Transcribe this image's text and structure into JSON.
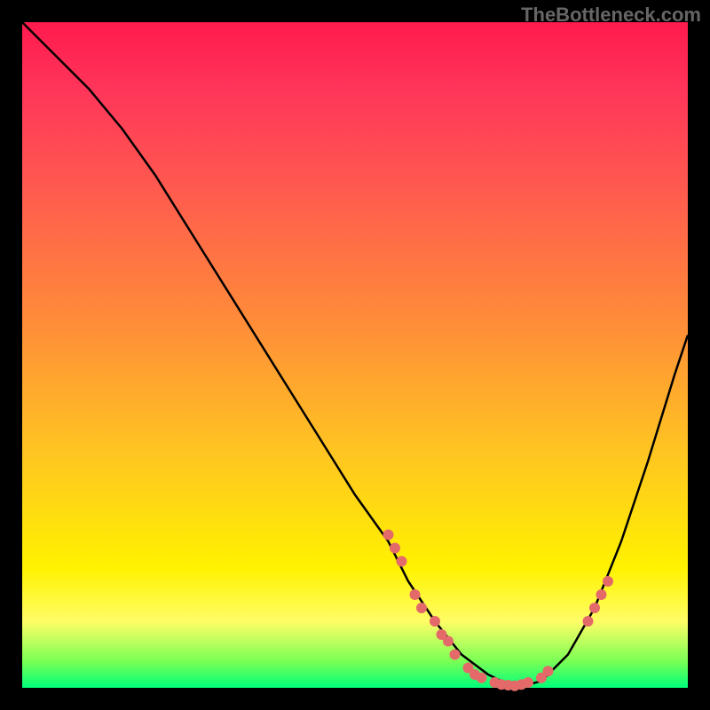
{
  "branding": {
    "watermark": "TheBottleneck.com"
  },
  "chart_data": {
    "type": "line",
    "title": "",
    "xlabel": "",
    "ylabel": "",
    "xlim": [
      0,
      100
    ],
    "ylim": [
      0,
      100
    ],
    "background_gradient": [
      "#ff1a4d",
      "#ff8c39",
      "#fff200",
      "#00ff7a"
    ],
    "series": [
      {
        "name": "bottleneck-curve",
        "color": "#000000",
        "x": [
          0,
          5,
          10,
          15,
          20,
          25,
          30,
          35,
          40,
          45,
          50,
          55,
          58,
          62,
          66,
          70,
          74,
          78,
          82,
          86,
          90,
          94,
          98,
          100
        ],
        "y": [
          100,
          95,
          90,
          84,
          77,
          69,
          61,
          53,
          45,
          37,
          29,
          22,
          16,
          10,
          5,
          2,
          0,
          1,
          5,
          12,
          22,
          34,
          47,
          53
        ]
      }
    ],
    "scatter_points": {
      "name": "highlight-dots",
      "color": "#e46a6a",
      "points": [
        {
          "x": 55,
          "y": 23
        },
        {
          "x": 56,
          "y": 21
        },
        {
          "x": 57,
          "y": 19
        },
        {
          "x": 59,
          "y": 14
        },
        {
          "x": 60,
          "y": 12
        },
        {
          "x": 62,
          "y": 10
        },
        {
          "x": 63,
          "y": 8
        },
        {
          "x": 64,
          "y": 7
        },
        {
          "x": 65,
          "y": 5
        },
        {
          "x": 67,
          "y": 3
        },
        {
          "x": 68,
          "y": 2
        },
        {
          "x": 69,
          "y": 1.5
        },
        {
          "x": 71,
          "y": 0.8
        },
        {
          "x": 72,
          "y": 0.5
        },
        {
          "x": 73,
          "y": 0.4
        },
        {
          "x": 74,
          "y": 0.3
        },
        {
          "x": 75,
          "y": 0.5
        },
        {
          "x": 76,
          "y": 0.8
        },
        {
          "x": 78,
          "y": 1.5
        },
        {
          "x": 79,
          "y": 2.5
        },
        {
          "x": 85,
          "y": 10
        },
        {
          "x": 86,
          "y": 12
        },
        {
          "x": 87,
          "y": 14
        },
        {
          "x": 88,
          "y": 16
        }
      ]
    }
  }
}
